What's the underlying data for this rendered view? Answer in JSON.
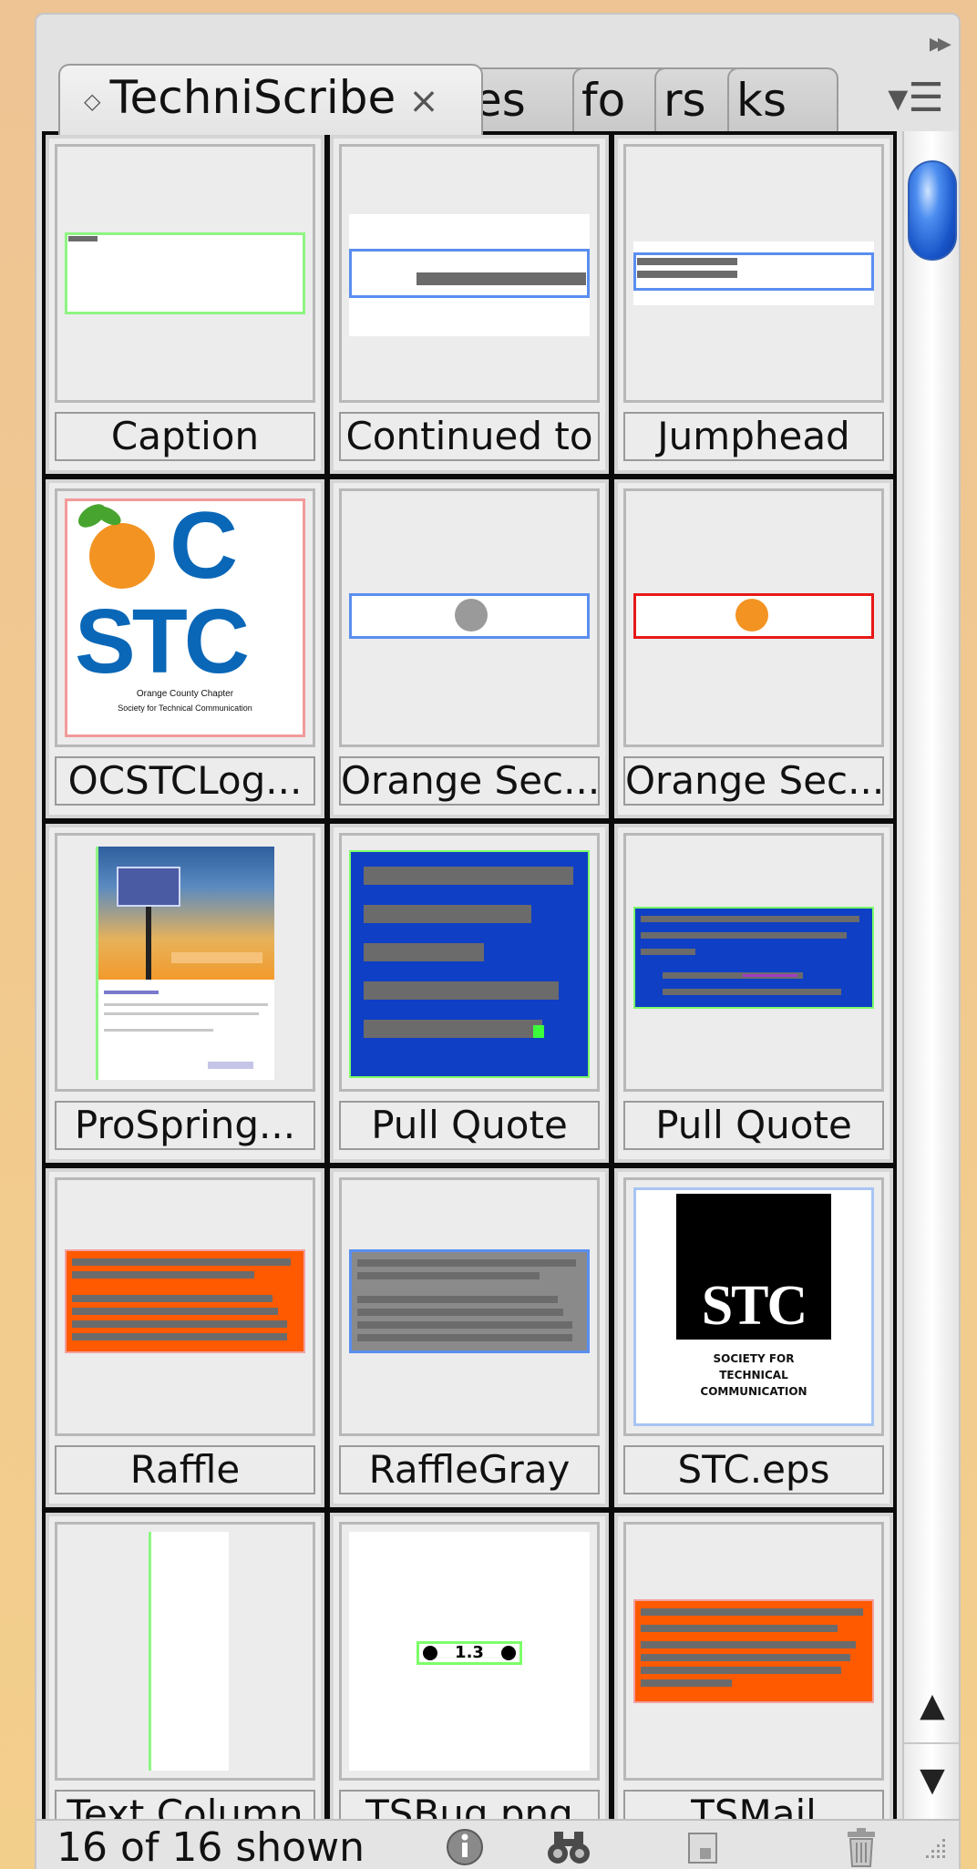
{
  "panel": {
    "tabs": [
      {
        "label": "TechniScribe",
        "active": true
      },
      {
        "label": "es",
        "active": false
      },
      {
        "label": "fo",
        "active": false
      },
      {
        "label": "rs",
        "active": false
      },
      {
        "label": "ks",
        "active": false
      }
    ],
    "close_glyph": "×",
    "grip_glyph": "◇",
    "collapse_glyph": "▸▸",
    "menu_glyph": "▾☰"
  },
  "items": [
    {
      "label": "Caption",
      "thumb": "caption"
    },
    {
      "label": "Continued to",
      "thumb": "continued"
    },
    {
      "label": "Jumphead",
      "thumb": "jumphead"
    },
    {
      "label": "OCSTCLog...",
      "thumb": "ocstc-logo",
      "logo_text_top": "C",
      "logo_text_bottom": "STC",
      "logo_caption_1": "Orange County Chapter",
      "logo_caption_2": "Society for Technical Communication"
    },
    {
      "label": "Orange Sec...",
      "thumb": "orange-sec-gray"
    },
    {
      "label": "Orange Sec...",
      "thumb": "orange-sec-red"
    },
    {
      "label": "ProSpring...",
      "thumb": "prospring"
    },
    {
      "label": "Pull Quote",
      "thumb": "pull-quote-1"
    },
    {
      "label": "Pull Quote",
      "thumb": "pull-quote-2"
    },
    {
      "label": "Raffle",
      "thumb": "raffle"
    },
    {
      "label": "RaffleGray",
      "thumb": "raffle-gray"
    },
    {
      "label": "STC.eps",
      "thumb": "stc-eps",
      "logo_text": "STC",
      "logo_caption_1": "SOCIETY FOR",
      "logo_caption_2": "TECHNICAL",
      "logo_caption_3": "COMMUNICATION"
    },
    {
      "label": "Text Column",
      "thumb": "text-column"
    },
    {
      "label": "TSBug.png",
      "thumb": "tsbug",
      "bug_text": "1.3"
    },
    {
      "label": "TSMail",
      "thumb": "tsmail"
    }
  ],
  "scrollbar": {
    "up_glyph": "▲",
    "down_glyph": "▼"
  },
  "status": {
    "shown_text": "16 of 16 shown",
    "icons": [
      "info-icon",
      "binoculars-icon",
      "new-item-icon",
      "trash-icon"
    ]
  },
  "colors": {
    "blue_fill": "#0f3fc4",
    "orange_fill": "#ff5a00",
    "green_border": "#7dff6a",
    "blue_border": "#5a8ef0",
    "red_border": "#e81818",
    "scroll_thumb": "#1854c8"
  }
}
